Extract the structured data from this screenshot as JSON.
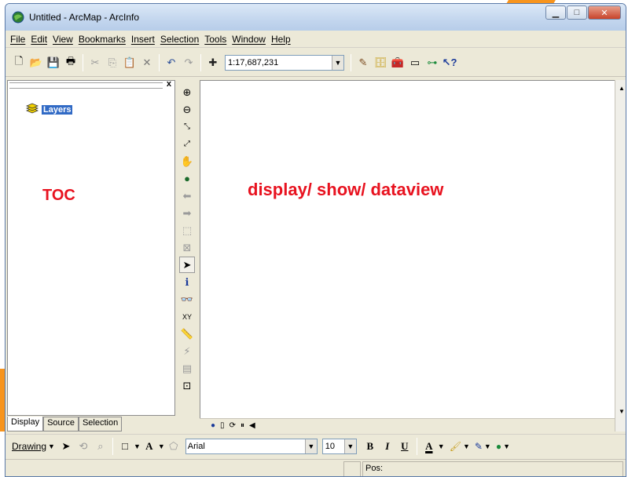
{
  "window": {
    "title": "Untitled - ArcMap - ArcInfo",
    "controls": [
      "minimize",
      "maximize",
      "close"
    ]
  },
  "menu": {
    "items": [
      "File",
      "Edit",
      "View",
      "Bookmarks",
      "Insert",
      "Selection",
      "Tools",
      "Window",
      "Help"
    ]
  },
  "standard_toolbar": {
    "scale_value": "1:17,687,231"
  },
  "toc": {
    "layers_label": "Layers",
    "annotation": "TOC",
    "tabs": [
      "Display",
      "Source",
      "Selection"
    ]
  },
  "display": {
    "annotation": "display/ show/ dataview"
  },
  "drawing_toolbar": {
    "label": "Drawing",
    "font_name": "Arial",
    "font_size": "10",
    "bold": "B",
    "italic": "I",
    "underline": "U",
    "font_color_letter": "A"
  },
  "statusbar": {
    "position_label": "Pos:"
  },
  "colors": {
    "annotation_red": "#e8121f",
    "accent_orange": "#f7941d",
    "selection_blue": "#316ac5"
  }
}
